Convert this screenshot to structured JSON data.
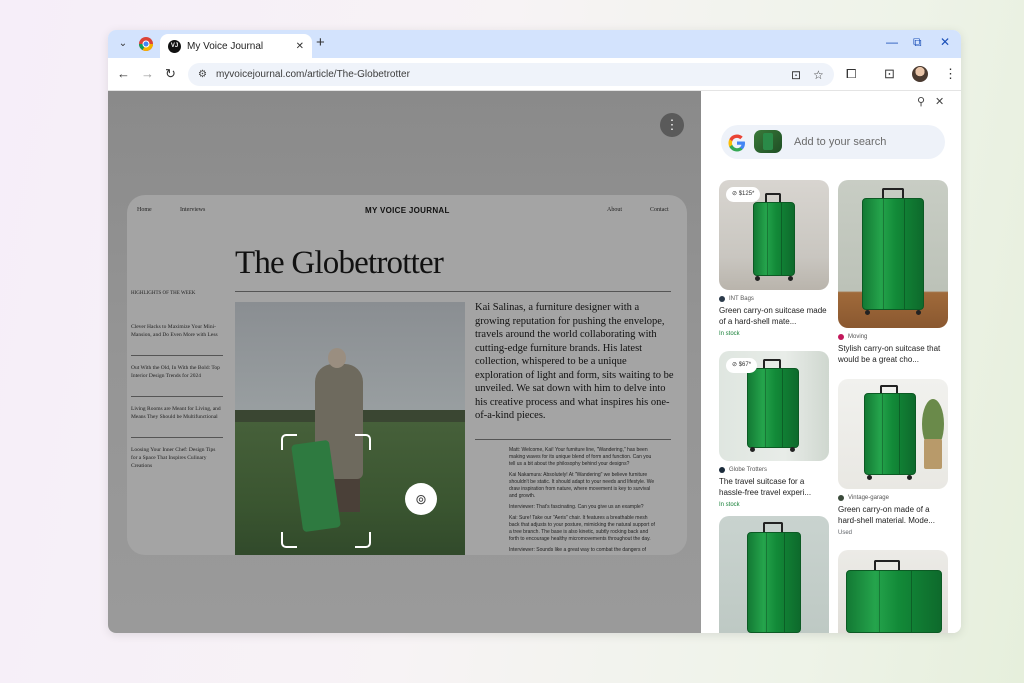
{
  "browser": {
    "tab_title": "My Voice Journal",
    "tab_favicon_text": "VJ",
    "url": "myvoicejournal.com/article/The-Globetrotter"
  },
  "article": {
    "brand": "MY VOICE JOURNAL",
    "nav": [
      "Home",
      "Interviews",
      "About",
      "Contact"
    ],
    "headline": "The Globetrotter",
    "highlights_label": "HIGHLIGHTS OF THE WEEK",
    "side_items": [
      "Clever Hacks to Maximize Your Mini-Mansion, and Do Even More with Less",
      "Out With the Old, In With the Bold: Top Interior Design Trends for 2024",
      "Living Rooms are Meant for Living, and Means They Should be Multifunctional",
      "Loosing Your Inner Chef: Design Tips for a Space That Inspires Culinary Creations"
    ],
    "intro": "Kai Salinas, a furniture designer with a growing reputation for pushing the envelope, travels around the world collaborating with cutting-edge furniture brands. His latest collection, whispered to be a unique exploration of light and form, sits waiting to be unveiled. We sat down with him to delve into his creative process and what inspires his one-of-a-kind pieces.",
    "interview": [
      "Matt: Welcome, Kai! Your furniture line, \"Wandering,\" has been making waves for its unique blend of form and function. Can you tell us a bit about the philosophy behind your designs?",
      "Kai Nakamura: Absolutely! At \"Wandering\" we believe furniture shouldn't be static. It should adapt to your needs and lifestyle. We draw inspiration from nature, where movement is key to survival and growth.",
      "Interviewer: That's fascinating. Can you give us an example?",
      "Kai: Sure! Take our \"Aeris\" chair. It features a breathable mesh back that adjusts to your posture, mimicking the natural support of a tree branch. The base is also kinetic, subtly rocking back and forth to encourage healthy micromovements throughout the day.",
      "Interviewer: Sounds like a great way to combat the dangers of"
    ]
  },
  "lens_panel": {
    "search_placeholder": "Add to your search",
    "results": [
      {
        "price": "$125*",
        "source": "INT Bags",
        "title": "Green carry-on suitcase made of a hard-shell mate...",
        "stock": "In stock",
        "source_color": "#2b3a4a"
      },
      {
        "price": "",
        "source": "Moving",
        "title": "Stylish carry-on suitcase that would be a great cho...",
        "stock": "",
        "source_color": "#c2185b"
      },
      {
        "price": "$67*",
        "source": "Globe Trotters",
        "title": "The travel suitcase for a hassle-free travel experi...",
        "stock": "In stock",
        "source_color": "#1a2a3a"
      },
      {
        "price": "",
        "source": "Vintage-garage",
        "title": "Green carry-on made of a hard-shell material. Mode...",
        "stock": "Used",
        "source_color": "#3a4a3a"
      }
    ]
  },
  "colors": {
    "in_stock": "#188038",
    "used": "#5f6368",
    "tab_strip": "#d3e3fd"
  }
}
